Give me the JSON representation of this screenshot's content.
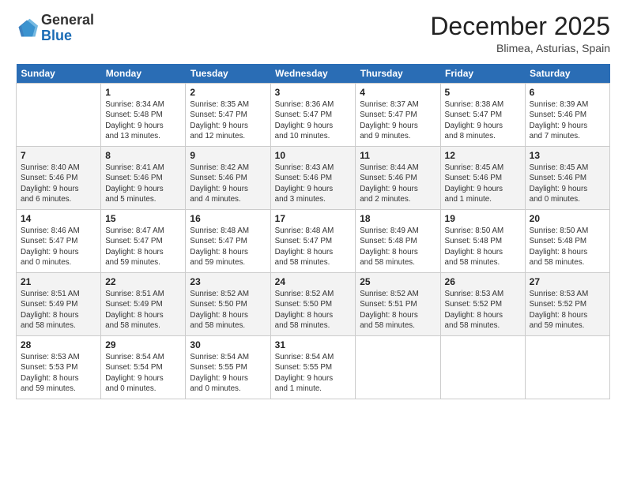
{
  "logo": {
    "general": "General",
    "blue": "Blue"
  },
  "header": {
    "month": "December 2025",
    "location": "Blimea, Asturias, Spain"
  },
  "days_of_week": [
    "Sunday",
    "Monday",
    "Tuesday",
    "Wednesday",
    "Thursday",
    "Friday",
    "Saturday"
  ],
  "weeks": [
    [
      {
        "day": "",
        "info": ""
      },
      {
        "day": "1",
        "info": "Sunrise: 8:34 AM\nSunset: 5:48 PM\nDaylight: 9 hours\nand 13 minutes."
      },
      {
        "day": "2",
        "info": "Sunrise: 8:35 AM\nSunset: 5:47 PM\nDaylight: 9 hours\nand 12 minutes."
      },
      {
        "day": "3",
        "info": "Sunrise: 8:36 AM\nSunset: 5:47 PM\nDaylight: 9 hours\nand 10 minutes."
      },
      {
        "day": "4",
        "info": "Sunrise: 8:37 AM\nSunset: 5:47 PM\nDaylight: 9 hours\nand 9 minutes."
      },
      {
        "day": "5",
        "info": "Sunrise: 8:38 AM\nSunset: 5:47 PM\nDaylight: 9 hours\nand 8 minutes."
      },
      {
        "day": "6",
        "info": "Sunrise: 8:39 AM\nSunset: 5:46 PM\nDaylight: 9 hours\nand 7 minutes."
      }
    ],
    [
      {
        "day": "7",
        "info": "Sunrise: 8:40 AM\nSunset: 5:46 PM\nDaylight: 9 hours\nand 6 minutes."
      },
      {
        "day": "8",
        "info": "Sunrise: 8:41 AM\nSunset: 5:46 PM\nDaylight: 9 hours\nand 5 minutes."
      },
      {
        "day": "9",
        "info": "Sunrise: 8:42 AM\nSunset: 5:46 PM\nDaylight: 9 hours\nand 4 minutes."
      },
      {
        "day": "10",
        "info": "Sunrise: 8:43 AM\nSunset: 5:46 PM\nDaylight: 9 hours\nand 3 minutes."
      },
      {
        "day": "11",
        "info": "Sunrise: 8:44 AM\nSunset: 5:46 PM\nDaylight: 9 hours\nand 2 minutes."
      },
      {
        "day": "12",
        "info": "Sunrise: 8:45 AM\nSunset: 5:46 PM\nDaylight: 9 hours\nand 1 minute."
      },
      {
        "day": "13",
        "info": "Sunrise: 8:45 AM\nSunset: 5:46 PM\nDaylight: 9 hours\nand 0 minutes."
      }
    ],
    [
      {
        "day": "14",
        "info": "Sunrise: 8:46 AM\nSunset: 5:47 PM\nDaylight: 9 hours\nand 0 minutes."
      },
      {
        "day": "15",
        "info": "Sunrise: 8:47 AM\nSunset: 5:47 PM\nDaylight: 8 hours\nand 59 minutes."
      },
      {
        "day": "16",
        "info": "Sunrise: 8:48 AM\nSunset: 5:47 PM\nDaylight: 8 hours\nand 59 minutes."
      },
      {
        "day": "17",
        "info": "Sunrise: 8:48 AM\nSunset: 5:47 PM\nDaylight: 8 hours\nand 58 minutes."
      },
      {
        "day": "18",
        "info": "Sunrise: 8:49 AM\nSunset: 5:48 PM\nDaylight: 8 hours\nand 58 minutes."
      },
      {
        "day": "19",
        "info": "Sunrise: 8:50 AM\nSunset: 5:48 PM\nDaylight: 8 hours\nand 58 minutes."
      },
      {
        "day": "20",
        "info": "Sunrise: 8:50 AM\nSunset: 5:48 PM\nDaylight: 8 hours\nand 58 minutes."
      }
    ],
    [
      {
        "day": "21",
        "info": "Sunrise: 8:51 AM\nSunset: 5:49 PM\nDaylight: 8 hours\nand 58 minutes."
      },
      {
        "day": "22",
        "info": "Sunrise: 8:51 AM\nSunset: 5:49 PM\nDaylight: 8 hours\nand 58 minutes."
      },
      {
        "day": "23",
        "info": "Sunrise: 8:52 AM\nSunset: 5:50 PM\nDaylight: 8 hours\nand 58 minutes."
      },
      {
        "day": "24",
        "info": "Sunrise: 8:52 AM\nSunset: 5:50 PM\nDaylight: 8 hours\nand 58 minutes."
      },
      {
        "day": "25",
        "info": "Sunrise: 8:52 AM\nSunset: 5:51 PM\nDaylight: 8 hours\nand 58 minutes."
      },
      {
        "day": "26",
        "info": "Sunrise: 8:53 AM\nSunset: 5:52 PM\nDaylight: 8 hours\nand 58 minutes."
      },
      {
        "day": "27",
        "info": "Sunrise: 8:53 AM\nSunset: 5:52 PM\nDaylight: 8 hours\nand 59 minutes."
      }
    ],
    [
      {
        "day": "28",
        "info": "Sunrise: 8:53 AM\nSunset: 5:53 PM\nDaylight: 8 hours\nand 59 minutes."
      },
      {
        "day": "29",
        "info": "Sunrise: 8:54 AM\nSunset: 5:54 PM\nDaylight: 9 hours\nand 0 minutes."
      },
      {
        "day": "30",
        "info": "Sunrise: 8:54 AM\nSunset: 5:55 PM\nDaylight: 9 hours\nand 0 minutes."
      },
      {
        "day": "31",
        "info": "Sunrise: 8:54 AM\nSunset: 5:55 PM\nDaylight: 9 hours\nand 1 minute."
      },
      {
        "day": "",
        "info": ""
      },
      {
        "day": "",
        "info": ""
      },
      {
        "day": "",
        "info": ""
      }
    ]
  ]
}
